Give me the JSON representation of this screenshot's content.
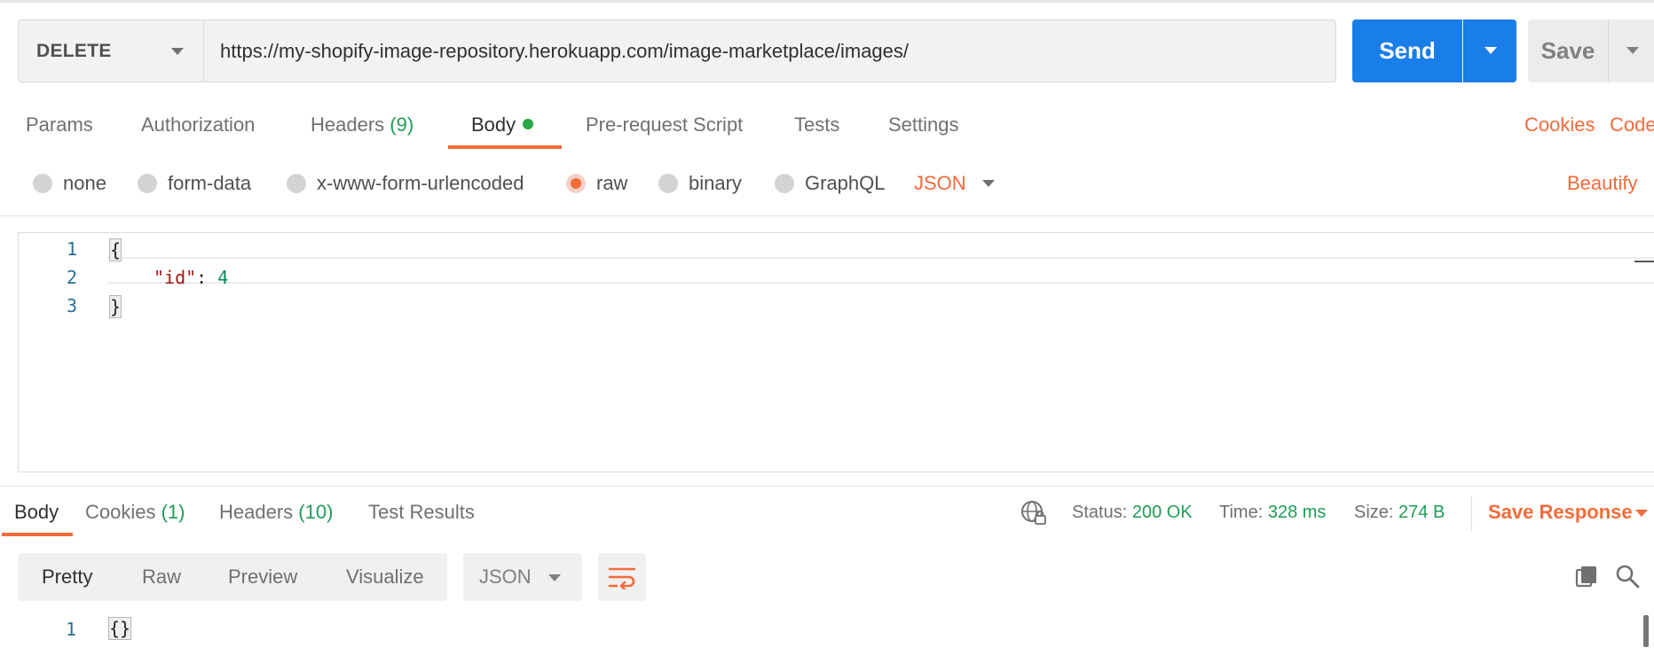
{
  "request": {
    "method": "DELETE",
    "url": "https://my-shopify-image-repository.herokuapp.com/image-marketplace/images/",
    "send_label": "Send",
    "save_label": "Save"
  },
  "request_tabs": [
    {
      "label": "Params",
      "count": ""
    },
    {
      "label": "Authorization",
      "count": ""
    },
    {
      "label": "Headers",
      "count": "(9)"
    },
    {
      "label": "Body",
      "count": ""
    },
    {
      "label": "Pre-request Script",
      "count": ""
    },
    {
      "label": "Tests",
      "count": ""
    },
    {
      "label": "Settings",
      "count": ""
    }
  ],
  "request_links": {
    "cookies": "Cookies",
    "code": "Code"
  },
  "body_types": [
    "none",
    "form-data",
    "x-www-form-urlencoded",
    "raw",
    "binary",
    "GraphQL"
  ],
  "body_selected": "raw",
  "body_format": "JSON",
  "beautify_label": "Beautify",
  "editor": {
    "line_numbers": [
      "1",
      "2",
      "3"
    ],
    "open_brace": "{",
    "key": "\"id\"",
    "colon": ": ",
    "value": "4",
    "close_brace": "}"
  },
  "response_tabs": [
    {
      "label": "Body",
      "count": ""
    },
    {
      "label": "Cookies",
      "count": "(1)"
    },
    {
      "label": "Headers",
      "count": "(10)"
    },
    {
      "label": "Test Results",
      "count": ""
    }
  ],
  "response_meta": {
    "status_label": "Status:",
    "status_value": "200 OK",
    "time_label": "Time:",
    "time_value": "328 ms",
    "size_label": "Size:",
    "size_value": "274 B",
    "save_response": "Save Response"
  },
  "response_views": [
    "Pretty",
    "Raw",
    "Preview",
    "Visualize"
  ],
  "response_format": "JSON",
  "response_body": {
    "line": "1",
    "content": "{}"
  },
  "colors": {
    "accent": "#f26b3a",
    "send_blue": "#1a7ee8",
    "success_green": "#1f9d55"
  }
}
